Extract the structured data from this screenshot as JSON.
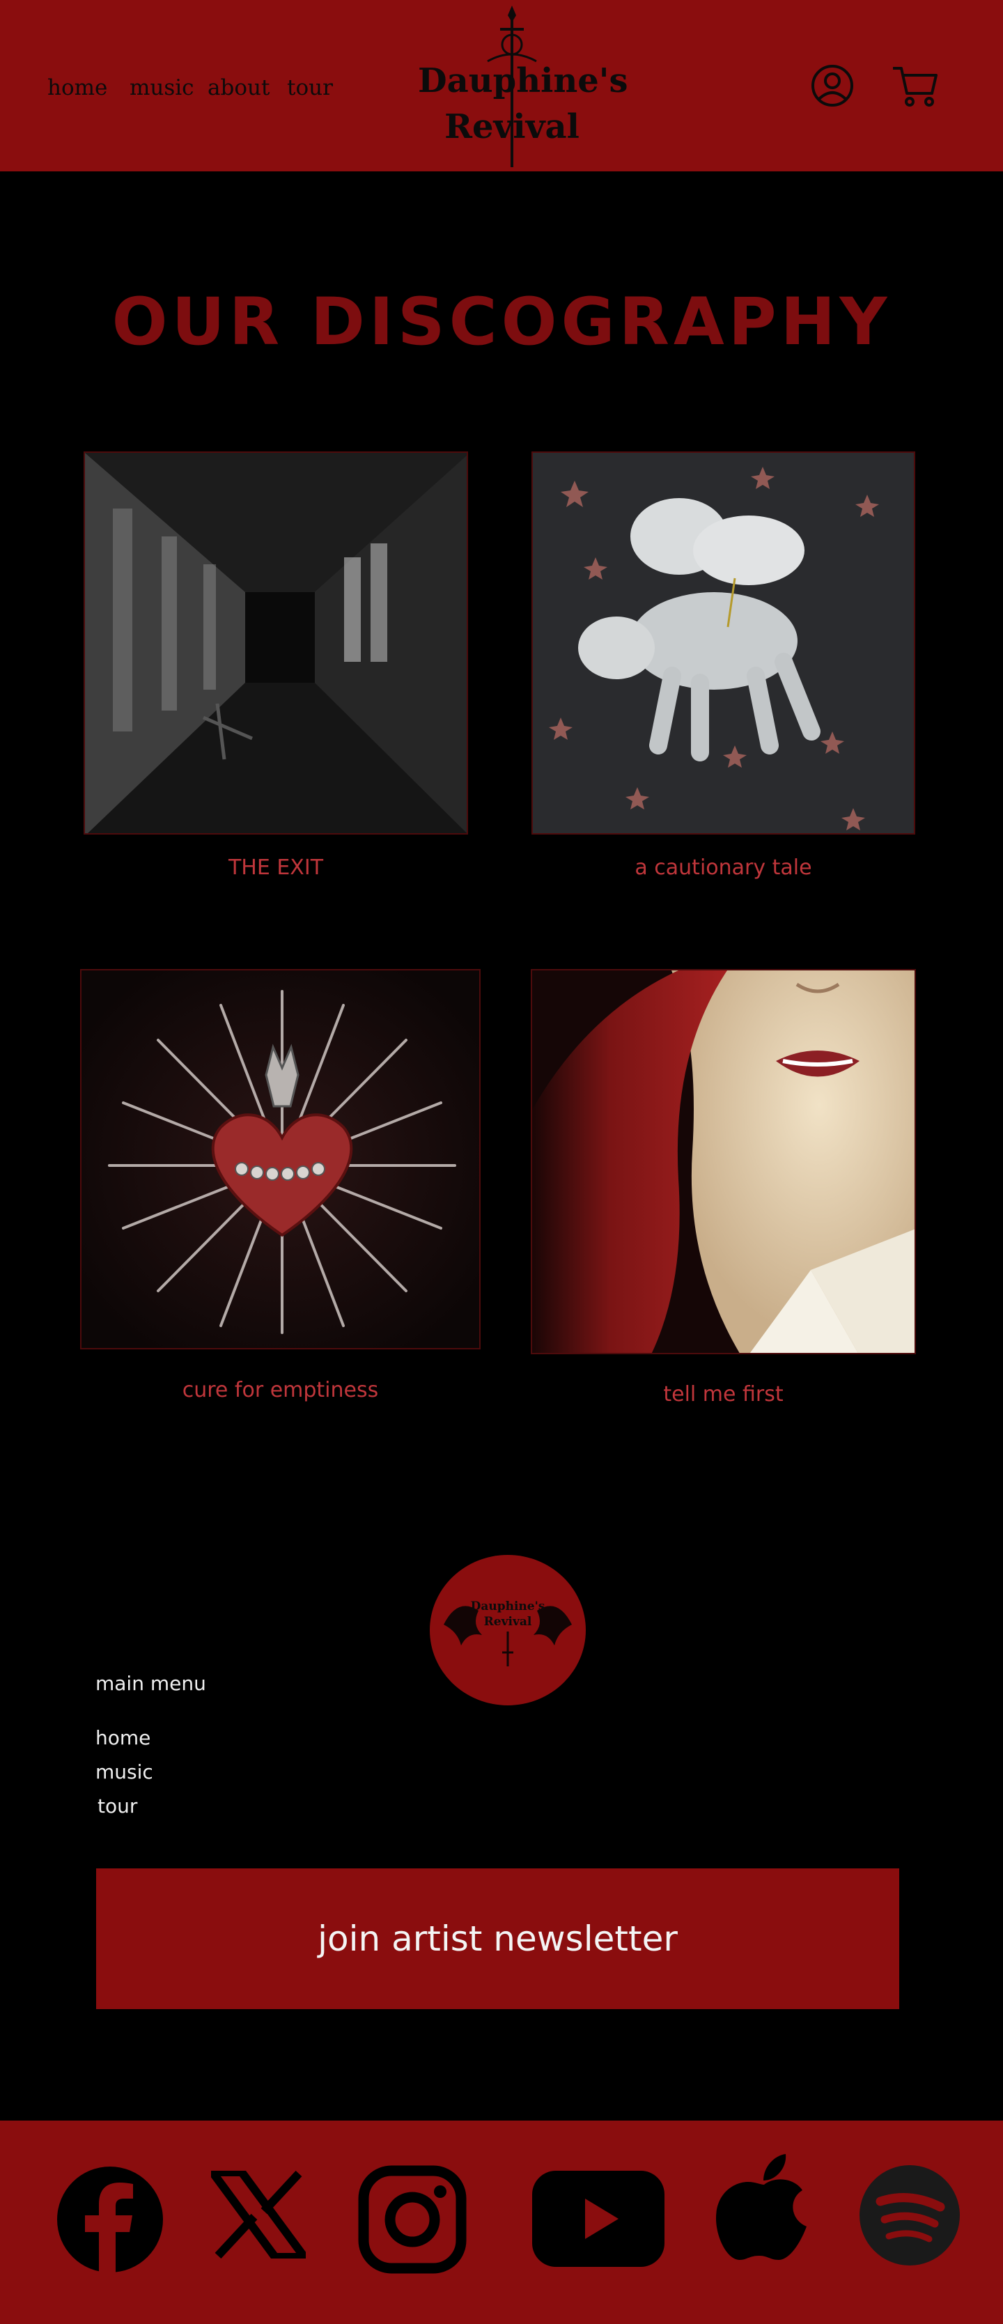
{
  "header": {
    "nav": [
      {
        "label": "home"
      },
      {
        "label": "music"
      },
      {
        "label": "about"
      },
      {
        "label": "tour"
      }
    ],
    "logo_line1": "Dauphine's",
    "logo_line2": "Revival",
    "account_icon": "account-icon",
    "cart_icon": "cart-icon"
  },
  "main": {
    "title": "our discography",
    "albums": [
      {
        "title": "THE EXIT",
        "art": "abandoned-corridor"
      },
      {
        "title": "a cautionary tale",
        "art": "winged-lamb"
      },
      {
        "title": "cure for emptiness",
        "art": "sacred-heart"
      },
      {
        "title": "tell me first",
        "art": "red-hair-portrait"
      }
    ]
  },
  "footer": {
    "logo_line1": "Dauphine's",
    "logo_line2": "Revival",
    "menu_heading": "main menu",
    "menu": [
      {
        "label": "home"
      },
      {
        "label": "music"
      },
      {
        "label": "tour"
      }
    ],
    "newsletter_label": "join artist newsletter",
    "social": [
      "facebook-icon",
      "x-icon",
      "instagram-icon",
      "youtube-icon",
      "apple-icon",
      "spotify-icon"
    ]
  },
  "colors": {
    "brand_red": "#8a0d0e",
    "title_red": "#7d0d0f",
    "label_red": "#c0363b",
    "background": "#000000"
  }
}
